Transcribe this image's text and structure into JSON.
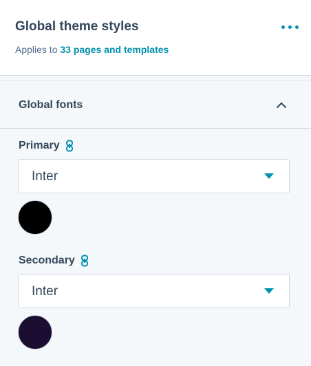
{
  "header": {
    "title": "Global theme styles",
    "subtitle_prefix": "Applies to",
    "subtitle_link": "33 pages and templates",
    "more_icon": "more-horizontal-icon"
  },
  "section": {
    "title": "Global fonts",
    "expanded": true,
    "chevron_icon": "chevron-up-icon"
  },
  "fonts": {
    "primary": {
      "label": "Primary",
      "linked": true,
      "font": "Inter",
      "color": "#000000"
    },
    "secondary": {
      "label": "Secondary",
      "linked": true,
      "font": "Inter",
      "color": "#1c0e32"
    }
  },
  "colors": {
    "accent": "#0091ae",
    "text": "#33475b"
  }
}
